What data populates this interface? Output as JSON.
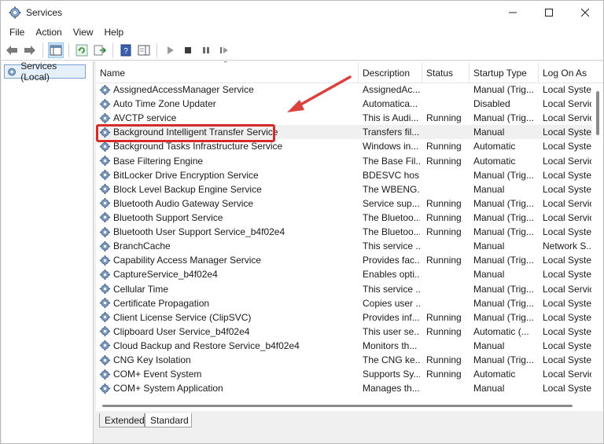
{
  "window": {
    "title": "Services"
  },
  "menu": [
    "File",
    "Action",
    "View",
    "Help"
  ],
  "tree": {
    "root_label": "Services (Local)"
  },
  "columns": {
    "name": "Name",
    "description": "Description",
    "status": "Status",
    "startup": "Startup Type",
    "logon": "Log On As"
  },
  "services": [
    {
      "name": "AssignedAccessManager Service",
      "description": "AssignedAc...",
      "status": "",
      "startup": "Manual (Trig...",
      "logon": "Local Syste..."
    },
    {
      "name": "Auto Time Zone Updater",
      "description": "Automatica...",
      "status": "",
      "startup": "Disabled",
      "logon": "Local Servic"
    },
    {
      "name": "AVCTP service",
      "description": "This is Audi...",
      "status": "Running",
      "startup": "Manual (Trig...",
      "logon": "Local Servic"
    },
    {
      "name": "Background Intelligent Transfer Service",
      "description": "Transfers fil...",
      "status": "",
      "startup": "Manual",
      "logon": "Local Syste..."
    },
    {
      "name": "Background Tasks Infrastructure Service",
      "description": "Windows in...",
      "status": "Running",
      "startup": "Automatic",
      "logon": "Local Syste..."
    },
    {
      "name": "Base Filtering Engine",
      "description": "The Base Fil...",
      "status": "Running",
      "startup": "Automatic",
      "logon": "Local Servic"
    },
    {
      "name": "BitLocker Drive Encryption Service",
      "description": "BDESVC hos...",
      "status": "",
      "startup": "Manual (Trig...",
      "logon": "Local Syste..."
    },
    {
      "name": "Block Level Backup Engine Service",
      "description": "The WBENG...",
      "status": "",
      "startup": "Manual",
      "logon": "Local Syste..."
    },
    {
      "name": "Bluetooth Audio Gateway Service",
      "description": "Service sup...",
      "status": "Running",
      "startup": "Manual (Trig...",
      "logon": "Local Servic"
    },
    {
      "name": "Bluetooth Support Service",
      "description": "The Bluetoo...",
      "status": "Running",
      "startup": "Manual (Trig...",
      "logon": "Local Servic"
    },
    {
      "name": "Bluetooth User Support Service_b4f02e4",
      "description": "The Bluetoo...",
      "status": "Running",
      "startup": "Manual (Trig...",
      "logon": "Local Syste..."
    },
    {
      "name": "BranchCache",
      "description": "This service ...",
      "status": "",
      "startup": "Manual",
      "logon": "Network S..."
    },
    {
      "name": "Capability Access Manager Service",
      "description": "Provides fac...",
      "status": "Running",
      "startup": "Manual (Trig...",
      "logon": "Local Syste..."
    },
    {
      "name": "CaptureService_b4f02e4",
      "description": "Enables opti...",
      "status": "",
      "startup": "Manual",
      "logon": "Local Syste..."
    },
    {
      "name": "Cellular Time",
      "description": "This service ...",
      "status": "",
      "startup": "Manual (Trig...",
      "logon": "Local Servic"
    },
    {
      "name": "Certificate Propagation",
      "description": "Copies user ...",
      "status": "",
      "startup": "Manual (Trig...",
      "logon": "Local Syste..."
    },
    {
      "name": "Client License Service (ClipSVC)",
      "description": "Provides inf...",
      "status": "Running",
      "startup": "Manual (Trig...",
      "logon": "Local Syste..."
    },
    {
      "name": "Clipboard User Service_b4f02e4",
      "description": "This user se...",
      "status": "Running",
      "startup": "Automatic (...",
      "logon": "Local Syste..."
    },
    {
      "name": "Cloud Backup and Restore Service_b4f02e4",
      "description": "Monitors th...",
      "status": "",
      "startup": "Manual",
      "logon": "Local Syste..."
    },
    {
      "name": "CNG Key Isolation",
      "description": "The CNG ke...",
      "status": "Running",
      "startup": "Manual (Trig...",
      "logon": "Local Syste..."
    },
    {
      "name": "COM+ Event System",
      "description": "Supports Sy...",
      "status": "Running",
      "startup": "Automatic",
      "logon": "Local Servic"
    },
    {
      "name": "COM+ System Application",
      "description": "Manages th...",
      "status": "",
      "startup": "Manual",
      "logon": "Local Syste..."
    }
  ],
  "tabs": [
    "Extended",
    "Standard"
  ],
  "colors": {
    "highlight": "#d52b2b",
    "annotation_arrow": "#d9413c",
    "tree_selection": "#e6f0fa"
  }
}
